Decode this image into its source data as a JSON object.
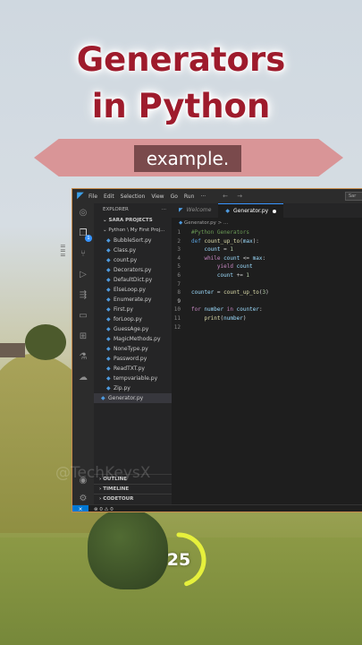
{
  "title": {
    "line1": "Generators",
    "line2": "in Python"
  },
  "subtitle": "example.",
  "vscode": {
    "menu": [
      "File",
      "Edit",
      "Selection",
      "View",
      "Go",
      "Run",
      "···"
    ],
    "nav": "← →",
    "search": "Sar",
    "explorer_label": "EXPLORER",
    "explorer_more": "···",
    "project": "SARA PROJECTS",
    "folder": "Python \\ My First Proj...",
    "files": [
      "BubbleSort.py",
      "Class.py",
      "count.py",
      "Decorators.py",
      "DefaultDict.py",
      "ElseLoop.py",
      "Enumerate.py",
      "First.py",
      "forLoop.py",
      "GuessAge.py",
      "MagicMethods.py",
      "NoneType.py",
      "Password.py",
      "ReadTXT.py",
      "tempvariable.py",
      "Zip.py"
    ],
    "root_file": "Generator.py",
    "sections": [
      "OUTLINE",
      "TIMELINE",
      "CODETOUR"
    ],
    "tabs": [
      {
        "label": "Welcome"
      },
      {
        "label": "Generator.py"
      }
    ],
    "breadcrumb": "Generator.py > ...",
    "line_numbers": [
      "1",
      "2",
      "3",
      "4",
      "5",
      "6",
      "7",
      "8",
      "9",
      "10",
      "11",
      "12"
    ],
    "status_problems": "⊗ 0 ⚠ 0",
    "status_remote": "⨯",
    "badge_count": "1"
  },
  "watermark": "@TechKeysX",
  "countdown": {
    "value": "25",
    "fraction": 0.45
  },
  "colors": {
    "title": "#9e1b2c",
    "accent": "#3794ff",
    "ring": "#e6f03c"
  }
}
